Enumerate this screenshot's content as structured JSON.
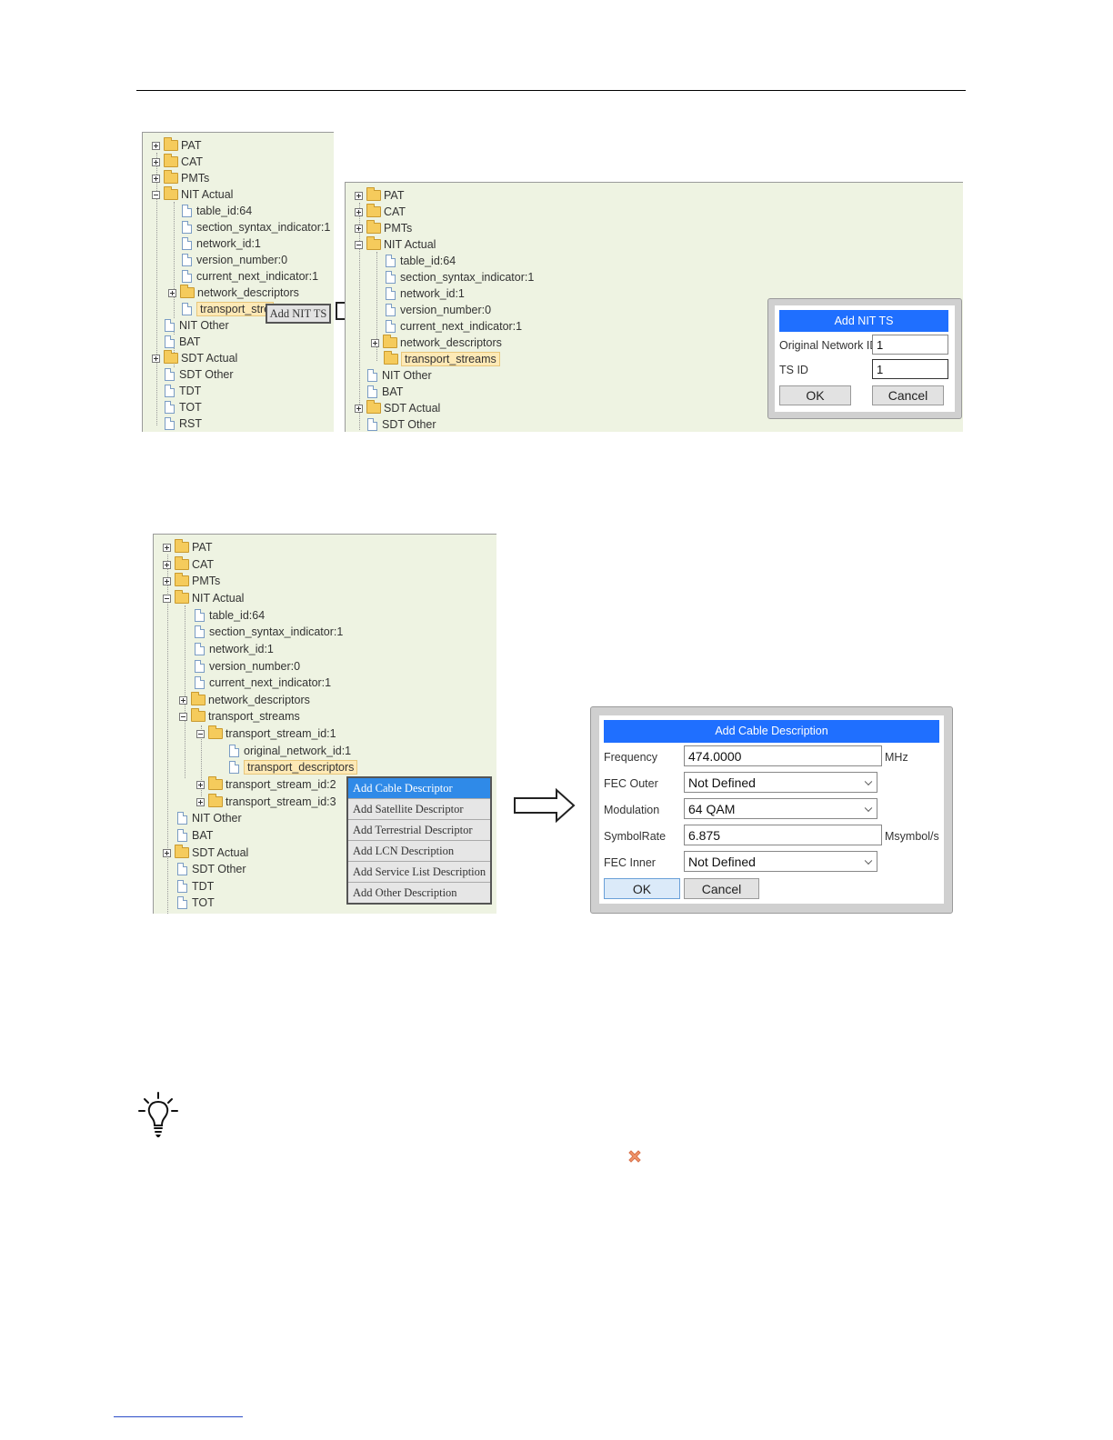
{
  "tree1": {
    "items": [
      "PAT",
      "CAT",
      "PMTs",
      "NIT Actual",
      "table_id:64",
      "section_syntax_indicator:1",
      "network_id:1",
      "version_number:0",
      "current_next_indicator:1",
      "network_descriptors",
      "transport_stre",
      "NIT Other",
      "BAT",
      "SDT Actual",
      "SDT Other",
      "TDT",
      "TOT",
      "RST"
    ],
    "context_label": "Add NIT TS"
  },
  "tree2": {
    "items": [
      "PAT",
      "CAT",
      "PMTs",
      "NIT Actual",
      "table_id:64",
      "section_syntax_indicator:1",
      "network_id:1",
      "version_number:0",
      "current_next_indicator:1",
      "network_descriptors",
      "transport_streams",
      "NIT Other",
      "BAT",
      "SDT Actual",
      "SDT Other"
    ]
  },
  "dialog_nit": {
    "title": "Add NIT TS",
    "original_network_id_label": "Original Network ID",
    "original_network_id_value": "1",
    "ts_id_label": "TS ID",
    "ts_id_value": "1",
    "ok_label": "OK",
    "cancel_label": "Cancel"
  },
  "tree3": {
    "items": [
      "PAT",
      "CAT",
      "PMTs",
      "NIT Actual",
      "table_id:64",
      "section_syntax_indicator:1",
      "network_id:1",
      "version_number:0",
      "current_next_indicator:1",
      "network_descriptors",
      "transport_streams",
      "transport_stream_id:1",
      "original_network_id:1",
      "transport_descriptors",
      "transport_stream_id:2",
      "transport_stream_id:3",
      "NIT Other",
      "BAT",
      "SDT Actual",
      "SDT Other",
      "TDT",
      "TOT"
    ]
  },
  "context_menu": {
    "items": [
      "Add Cable Descriptor",
      "Add Satellite Descriptor",
      "Add Terrestrial Descriptor",
      "Add LCN Description",
      "Add Service List Description",
      "Add Other Description"
    ]
  },
  "dialog_cable": {
    "title": "Add Cable Description",
    "frequency_label": "Frequency",
    "frequency_value": "474.0000",
    "frequency_unit": "MHz",
    "fec_outer_label": "FEC Outer",
    "fec_outer_value": "Not Defined",
    "modulation_label": "Modulation",
    "modulation_value": "64 QAM",
    "symbolrate_label": "SymbolRate",
    "symbolrate_value": "6.875",
    "symbolrate_unit": "Msymbol/s",
    "fec_inner_label": "FEC Inner",
    "fec_inner_value": "Not Defined",
    "ok_label": "OK",
    "cancel_label": "Cancel"
  },
  "colors": {
    "accent": "#1f6fff",
    "panel": "#eef3e2",
    "menu_active": "#2f8ae8",
    "folder": "#f5cb5c"
  },
  "icons": [
    "lightbulb-icon",
    "close-icon"
  ]
}
